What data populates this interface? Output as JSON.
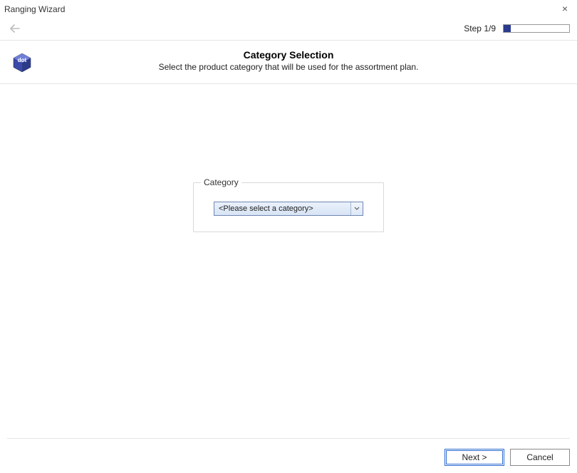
{
  "window": {
    "title": "Ranging Wizard"
  },
  "step": {
    "label": "Step 1/9",
    "progress_percent": 11
  },
  "header": {
    "title": "Category Selection",
    "subtitle": "Select the product category that will be used for the assortment plan."
  },
  "logo": {
    "text": "dot"
  },
  "form": {
    "category_group_label": "Category",
    "category_select_placeholder": "<Please select a category>"
  },
  "buttons": {
    "next": "Next >",
    "cancel": "Cancel"
  }
}
